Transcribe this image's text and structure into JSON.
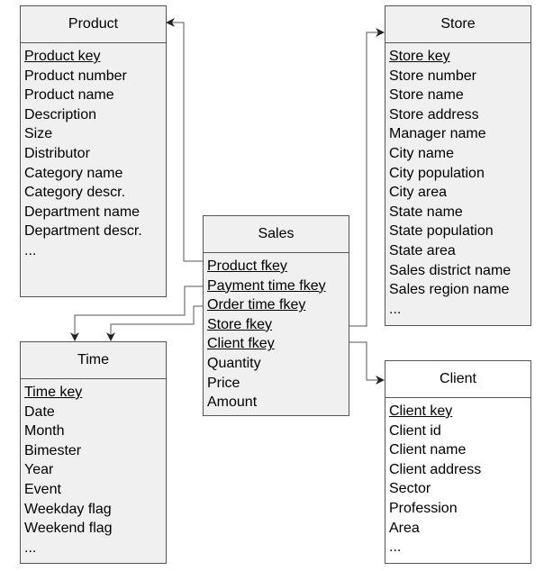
{
  "colors": {
    "entity_fill": "#f0f0f0",
    "client_fill": "#ffffff",
    "line": "#555555"
  },
  "entities": {
    "product": {
      "title": "Product",
      "attributes": [
        {
          "text": "Product key",
          "key": true
        },
        {
          "text": "Product number"
        },
        {
          "text": "Product name"
        },
        {
          "text": "Description"
        },
        {
          "text": "Size"
        },
        {
          "text": "Distributor"
        },
        {
          "text": "Category name"
        },
        {
          "text": "Category descr."
        },
        {
          "text": "Department name"
        },
        {
          "text": "Department descr."
        },
        {
          "text": "..."
        }
      ]
    },
    "store": {
      "title": "Store",
      "attributes": [
        {
          "text": "Store key",
          "key": true
        },
        {
          "text": "Store number"
        },
        {
          "text": "Store name"
        },
        {
          "text": "Store address"
        },
        {
          "text": "Manager name"
        },
        {
          "text": "City name"
        },
        {
          "text": "City population"
        },
        {
          "text": "City area"
        },
        {
          "text": "State name"
        },
        {
          "text": "State population"
        },
        {
          "text": "State area"
        },
        {
          "text": "Sales district name"
        },
        {
          "text": "Sales region name"
        },
        {
          "text": "..."
        }
      ]
    },
    "sales": {
      "title": "Sales",
      "attributes": [
        {
          "text": "Product fkey",
          "key": true
        },
        {
          "text": "Payment time fkey",
          "key": true
        },
        {
          "text": "Order time fkey",
          "key": true
        },
        {
          "text": "Store fkey",
          "key": true
        },
        {
          "text": "Client fkey",
          "key": true
        },
        {
          "text": "Quantity"
        },
        {
          "text": "Price"
        },
        {
          "text": "Amount"
        }
      ]
    },
    "time": {
      "title": "Time",
      "attributes": [
        {
          "text": "Time key",
          "key": true
        },
        {
          "text": "Date"
        },
        {
          "text": "Month"
        },
        {
          "text": "Bimester"
        },
        {
          "text": "Year"
        },
        {
          "text": "Event"
        },
        {
          "text": "Weekday  flag"
        },
        {
          "text": "Weekend  flag"
        },
        {
          "text": "..."
        }
      ]
    },
    "client": {
      "title": "Client",
      "attributes": [
        {
          "text": "Client key",
          "key": true
        },
        {
          "text": "Client id"
        },
        {
          "text": "Client name"
        },
        {
          "text": "Client address"
        },
        {
          "text": "Sector"
        },
        {
          "text": "Profession"
        },
        {
          "text": "Area"
        },
        {
          "text": "..."
        }
      ]
    }
  },
  "relationships": [
    {
      "from": "Sales.Product fkey",
      "to": "Product"
    },
    {
      "from": "Sales.Payment time fkey",
      "to": "Time"
    },
    {
      "from": "Sales.Order time fkey",
      "to": "Time"
    },
    {
      "from": "Sales.Store fkey",
      "to": "Store"
    },
    {
      "from": "Sales.Client fkey",
      "to": "Client"
    }
  ]
}
